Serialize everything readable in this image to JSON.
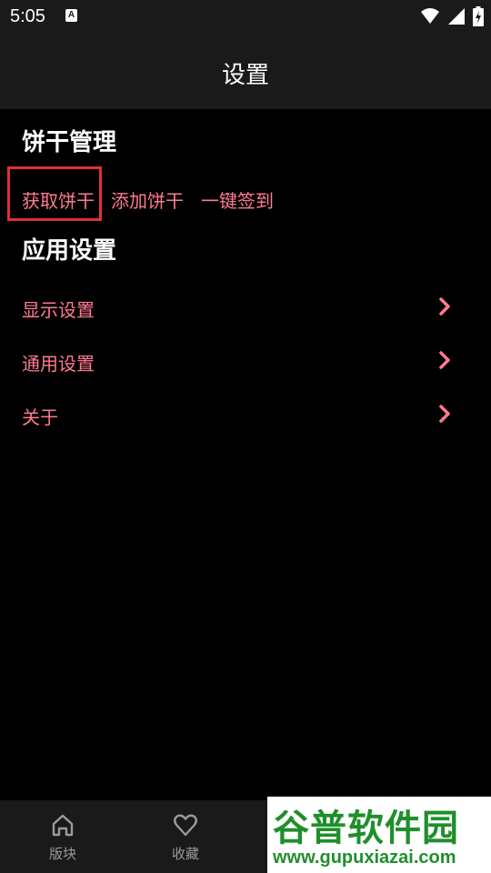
{
  "status_bar": {
    "time": "5:05",
    "notification_icon": "A"
  },
  "header": {
    "title": "设置"
  },
  "cookie_section": {
    "title": "饼干管理",
    "actions": [
      "获取饼干",
      "添加饼干",
      "一键签到"
    ]
  },
  "app_section": {
    "title": "应用设置",
    "items": [
      "显示设置",
      "通用设置",
      "关于"
    ]
  },
  "bottom_nav": {
    "items": [
      "版块",
      "收藏"
    ]
  },
  "watermark": {
    "title": "谷普软件园",
    "url": "www.gupuxiazai.com"
  },
  "colors": {
    "accent": "#ff7a8f",
    "highlight_box": "#e03030",
    "bar_bg": "#1a1a1a"
  }
}
